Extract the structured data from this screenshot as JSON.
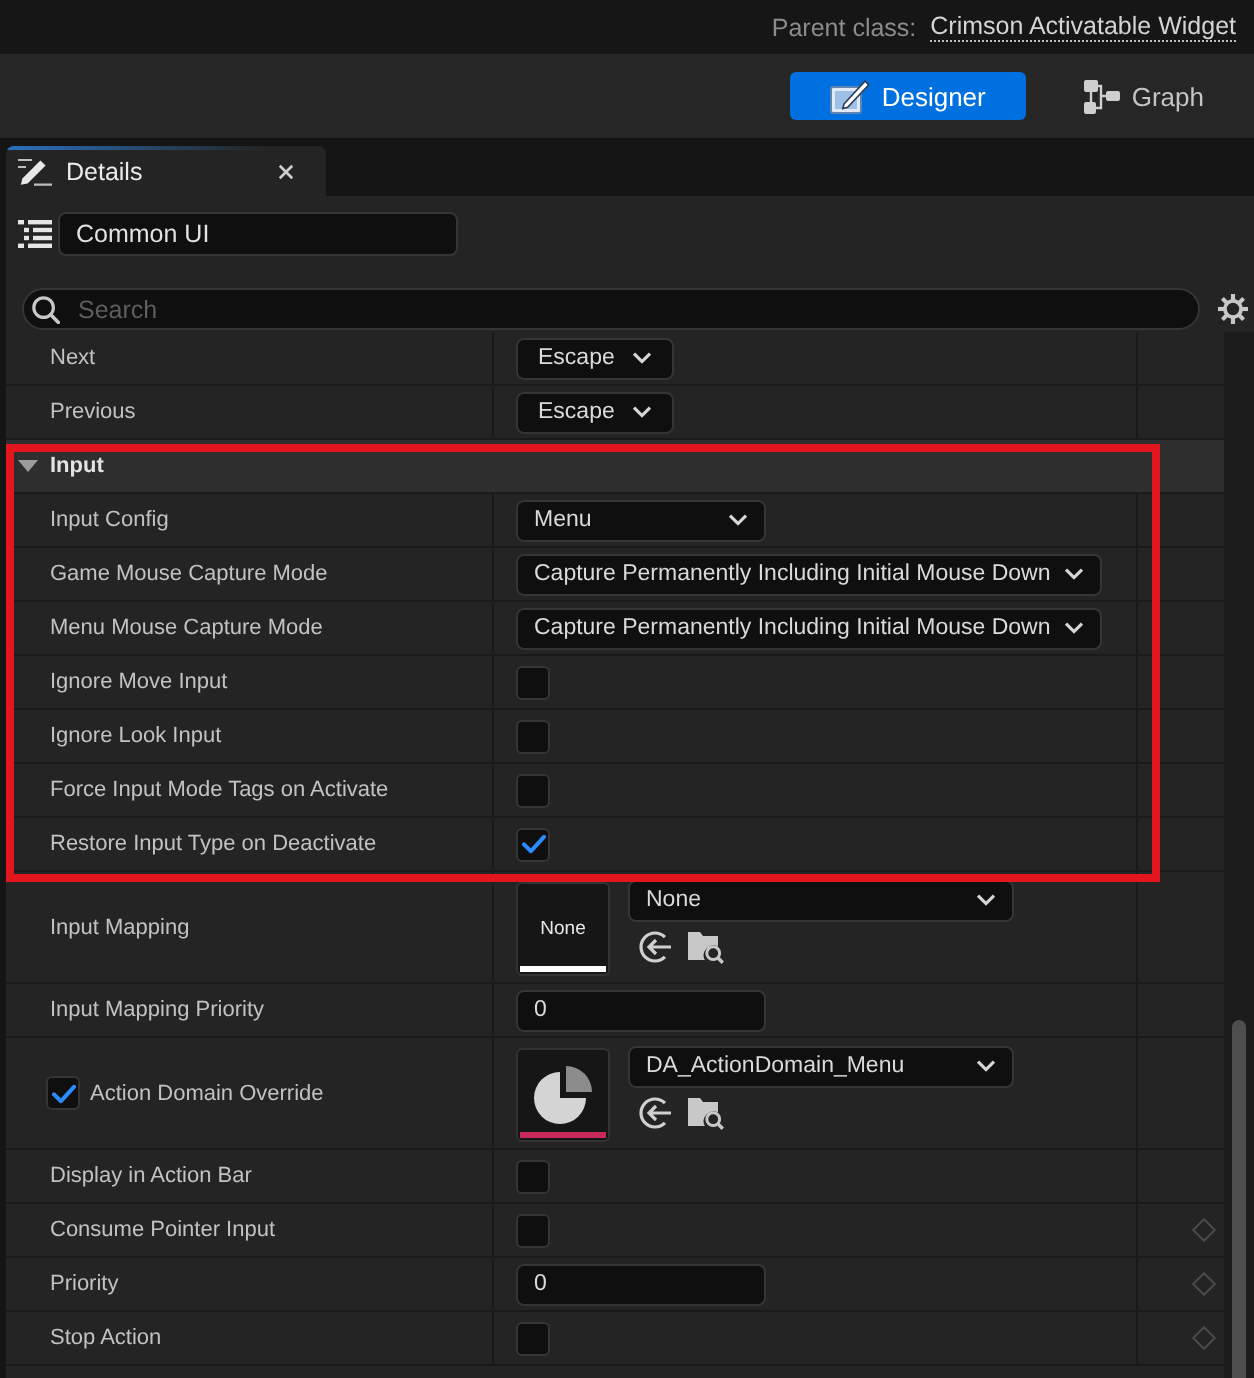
{
  "top_bar": {
    "parent_class_label": "Parent class:",
    "parent_class": "Crimson Activatable Widget"
  },
  "modes": [
    {
      "kind": "designer",
      "label": "Designer",
      "selected": true
    },
    {
      "kind": "graph",
      "label": "Graph",
      "selected": false
    }
  ],
  "panel_tab": {
    "title": "Details"
  },
  "filter": {
    "value": "Common UI"
  },
  "search": {
    "placeholder": "Search"
  },
  "row_groups": [
    {
      "outlined": false,
      "rows": [
        {
          "kind": "key",
          "name": "Next",
          "value": "Escape"
        },
        {
          "kind": "key",
          "name": "Previous",
          "value": "Escape"
        }
      ]
    },
    {
      "outlined": true,
      "rows": [
        {
          "kind": "category",
          "name": "Input",
          "expanded": true
        },
        {
          "kind": "enum",
          "name": "Input Config",
          "value": "Menu"
        },
        {
          "kind": "enum",
          "name": "Game Mouse Capture Mode",
          "value": "Capture Permanently Including Initial Mouse Down"
        },
        {
          "kind": "enum",
          "name": "Menu Mouse Capture Mode",
          "value": "Capture Permanently Including Initial Mouse Down"
        },
        {
          "kind": "checkbox",
          "name": "Ignore Move Input",
          "checked": false
        },
        {
          "kind": "checkbox",
          "name": "Ignore Look Input",
          "checked": false
        },
        {
          "kind": "checkbox",
          "name": "Force Input Mode Tags on Activate",
          "checked": false
        },
        {
          "kind": "checkbox",
          "name": "Restore Input Type on Deactivate",
          "checked": true
        }
      ]
    },
    {
      "outlined": false,
      "rows": [
        {
          "kind": "asset",
          "name": "Input Mapping",
          "value": "None",
          "thumbnail_label": "None",
          "color": "#ffffff"
        },
        {
          "kind": "number",
          "name": "Input Mapping Priority",
          "value": "0"
        },
        {
          "kind": "asset",
          "name": "Action Domain Override",
          "value": "DA_ActionDomain_Menu",
          "color": "#c8285a",
          "override_checked": true
        },
        {
          "kind": "checkbox",
          "name": "Display in Action Bar",
          "checked": false
        },
        {
          "kind": "checkbox",
          "name": "Consume Pointer Input",
          "checked": false,
          "keyframe": true
        },
        {
          "kind": "number",
          "name": "Priority",
          "value": "0",
          "keyframe": true
        },
        {
          "kind": "checkbox",
          "name": "Stop Action",
          "checked": false,
          "keyframe": true
        }
      ]
    }
  ]
}
